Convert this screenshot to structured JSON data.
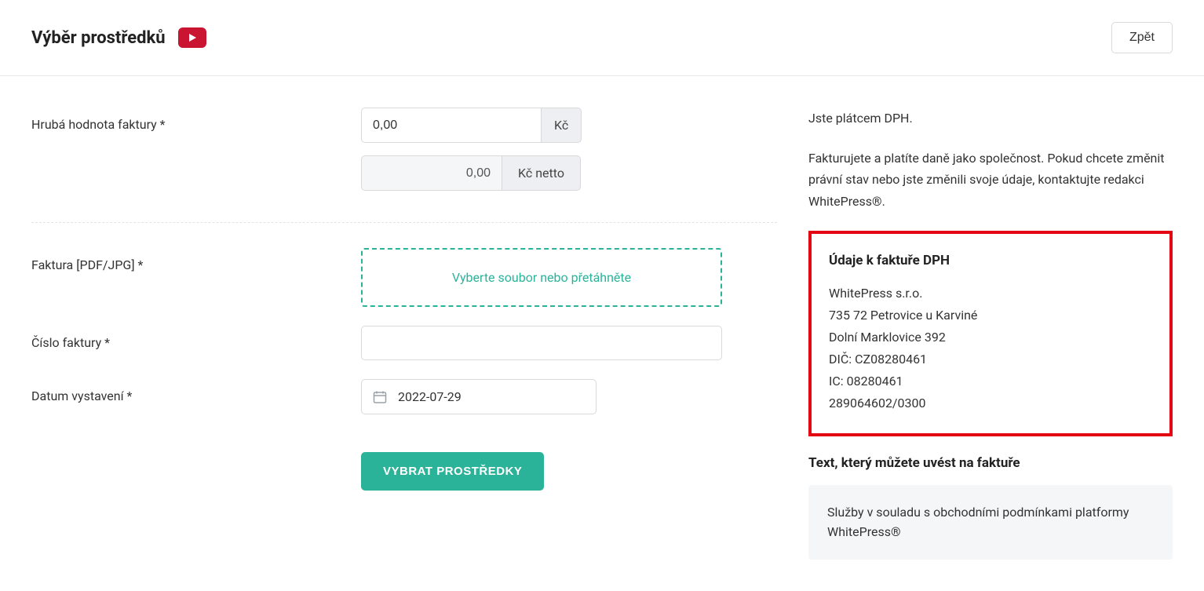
{
  "header": {
    "title": "Výběr prostředků",
    "back_label": "Zpět"
  },
  "form": {
    "gross_label": "Hrubá hodnota faktury *",
    "gross_value": "0,00",
    "gross_suffix": "Kč",
    "netto_value": "0,00",
    "netto_suffix": "Kč netto",
    "file_label": "Faktura [PDF/JPG] *",
    "dropzone_text": "Vyberte soubor nebo přetáhněte",
    "invoice_number_label": "Číslo faktury *",
    "invoice_number_value": "",
    "date_label": "Datum vystavení *",
    "date_value": "2022-07-29",
    "submit_label": "VYBRAT PROSTŘEDKY"
  },
  "sidebar": {
    "vat_status": "Jste plátcem DPH.",
    "company_info": "Fakturujete a platíte daně jako společnost. Pokud chcete změnit právní stav nebo jste změnili svoje údaje, kontaktujte redakci WhitePress®.",
    "invoice_heading": "Údaje k faktuře DPH",
    "details": {
      "company": "WhitePress s.r.o.",
      "zip_city": "735 72 Petrovice u Karviné",
      "street": "Dolní Marklovice 392",
      "dic": "DIČ: CZ08280461",
      "ic": "IC: 08280461",
      "account": "289064602/0300"
    },
    "note_heading": "Text, který můžete uvést na faktuře",
    "note_text": "Služby v souladu s obchodními podmínkami platformy WhitePress®"
  }
}
